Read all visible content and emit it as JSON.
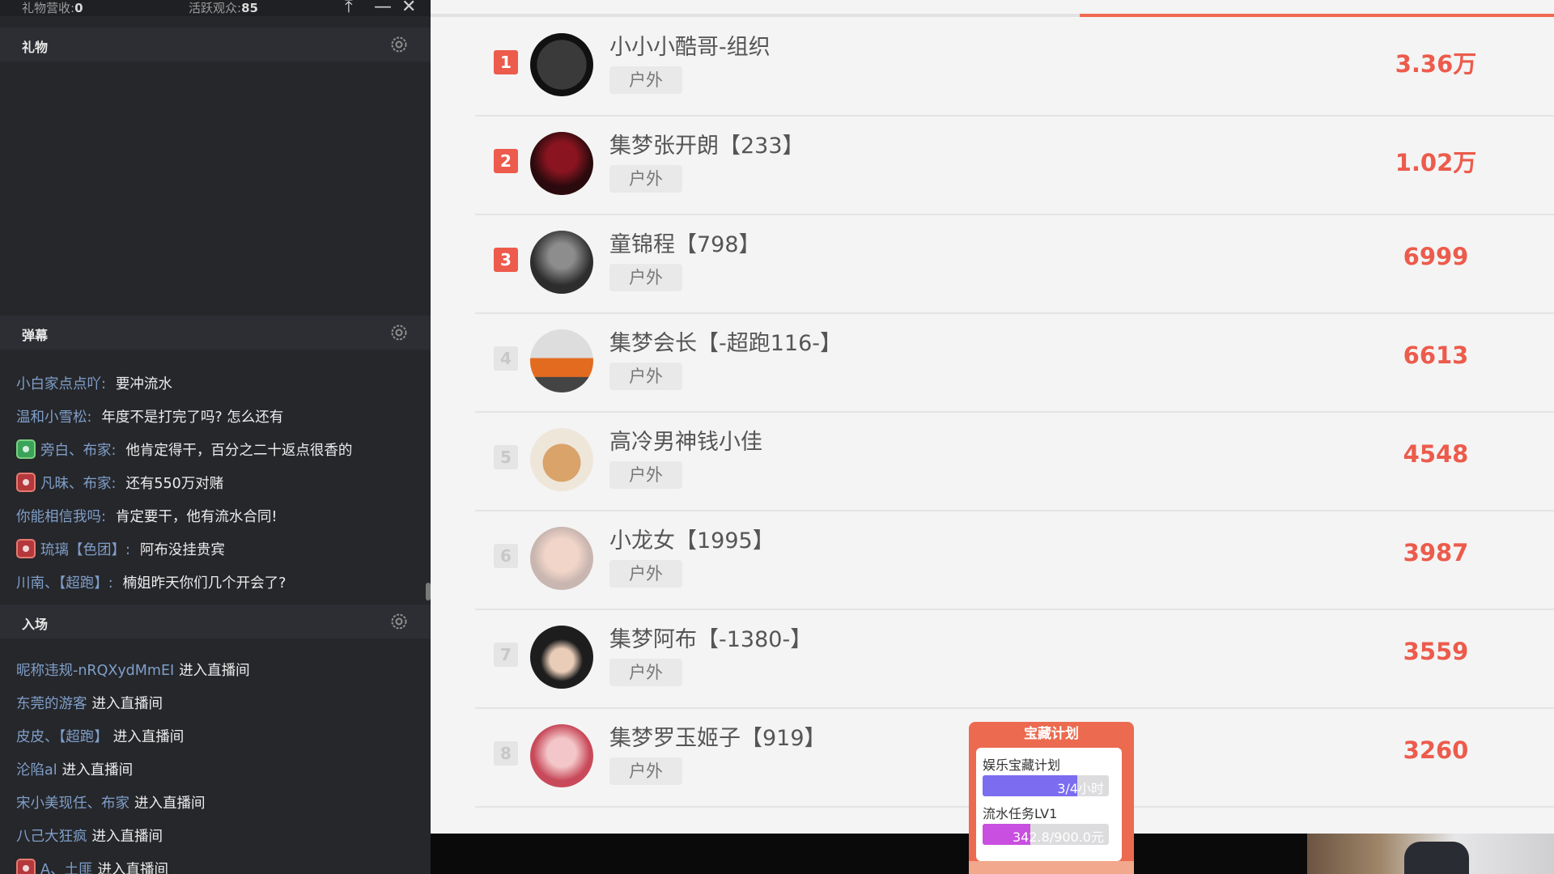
{
  "window": {
    "stats": [
      {
        "label": "礼物营收:",
        "value": "0"
      },
      {
        "label": "活跃观众:",
        "value": "85"
      }
    ],
    "controls": {
      "upload": "⤒",
      "minimize": "—",
      "close": "✕"
    }
  },
  "sections": {
    "gifts": {
      "title": "礼物"
    },
    "danmu": {
      "title": "弹幕"
    },
    "entry": {
      "title": "入场"
    }
  },
  "danmu_messages": [
    {
      "user": "小白家点点吖:",
      "text": "要冲流水",
      "badge": null
    },
    {
      "user": "温和小雪松:",
      "text": "年度不是打完了吗? 怎么还有",
      "badge": null
    },
    {
      "user": "旁白、布家:",
      "text": "他肯定得干，百分之二十返点很香的",
      "badge": "green"
    },
    {
      "user": "凡昧、布家:",
      "text": "还有550万对赌",
      "badge": "red"
    },
    {
      "user": "你能相信我吗:",
      "text": "肯定要干，他有流水合同!",
      "badge": null
    },
    {
      "user": "琉璃【色团】:",
      "text": "阿布没挂贵宾",
      "badge": "red"
    },
    {
      "user": "川南、【超跑】:",
      "text": "楠姐昨天你们几个开会了?",
      "badge": null
    }
  ],
  "entry_messages": [
    {
      "user": "昵称违规-nRQXydMmEI",
      "text": "进入直播间",
      "badge": null
    },
    {
      "user": "东莞的游客",
      "text": "进入直播间",
      "badge": null
    },
    {
      "user": "皮皮、【超跑】",
      "text": "进入直播间",
      "badge": null
    },
    {
      "user": "沦陷al",
      "text": "进入直播间",
      "badge": null
    },
    {
      "user": "宋小美现任、布家",
      "text": "进入直播间",
      "badge": null
    },
    {
      "user": "八己大狂疯",
      "text": "进入直播间",
      "badge": null
    },
    {
      "user": "A、土匪",
      "text": "进入直播间",
      "badge": "red"
    }
  ],
  "ranking": [
    {
      "rank": "1",
      "name": "小小小酷哥-组织",
      "tag": "户外",
      "score": "3.36万",
      "avatar": "logo"
    },
    {
      "rank": "2",
      "name": "集梦张开朗【233】",
      "tag": "户外",
      "score": "1.02万",
      "avatar": "red"
    },
    {
      "rank": "3",
      "name": "童锦程【798】",
      "tag": "户外",
      "score": "6999",
      "avatar": "gray"
    },
    {
      "rank": "4",
      "name": "集梦会长【-超跑116-】",
      "tag": "户外",
      "score": "6613",
      "avatar": "car"
    },
    {
      "rank": "5",
      "name": "高冷男神钱小佳",
      "tag": "户外",
      "score": "4548",
      "avatar": "dog"
    },
    {
      "rank": "6",
      "name": "小龙女【1995】",
      "tag": "户外",
      "score": "3987",
      "avatar": "girl"
    },
    {
      "rank": "7",
      "name": "集梦阿布【-1380-】",
      "tag": "户外",
      "score": "3559",
      "avatar": "boy"
    },
    {
      "rank": "8",
      "name": "集梦罗玉姬子【919】",
      "tag": "户外",
      "score": "3260",
      "avatar": "pink"
    }
  ],
  "treasure": {
    "title": "宝藏计划",
    "items": [
      {
        "label": "娱乐宝藏计划",
        "progress_text": "3/4小时",
        "progress": 0.75,
        "color": "#7b6cf0"
      },
      {
        "label": "流水任务LV1",
        "progress_text": "342.8/900.0元",
        "progress": 0.38,
        "color": "#c94fe0"
      }
    ]
  },
  "colors": {
    "accent": "#ec5b4c",
    "panel_dark": "#26272b",
    "rank_bg": "#f4f4f4"
  }
}
